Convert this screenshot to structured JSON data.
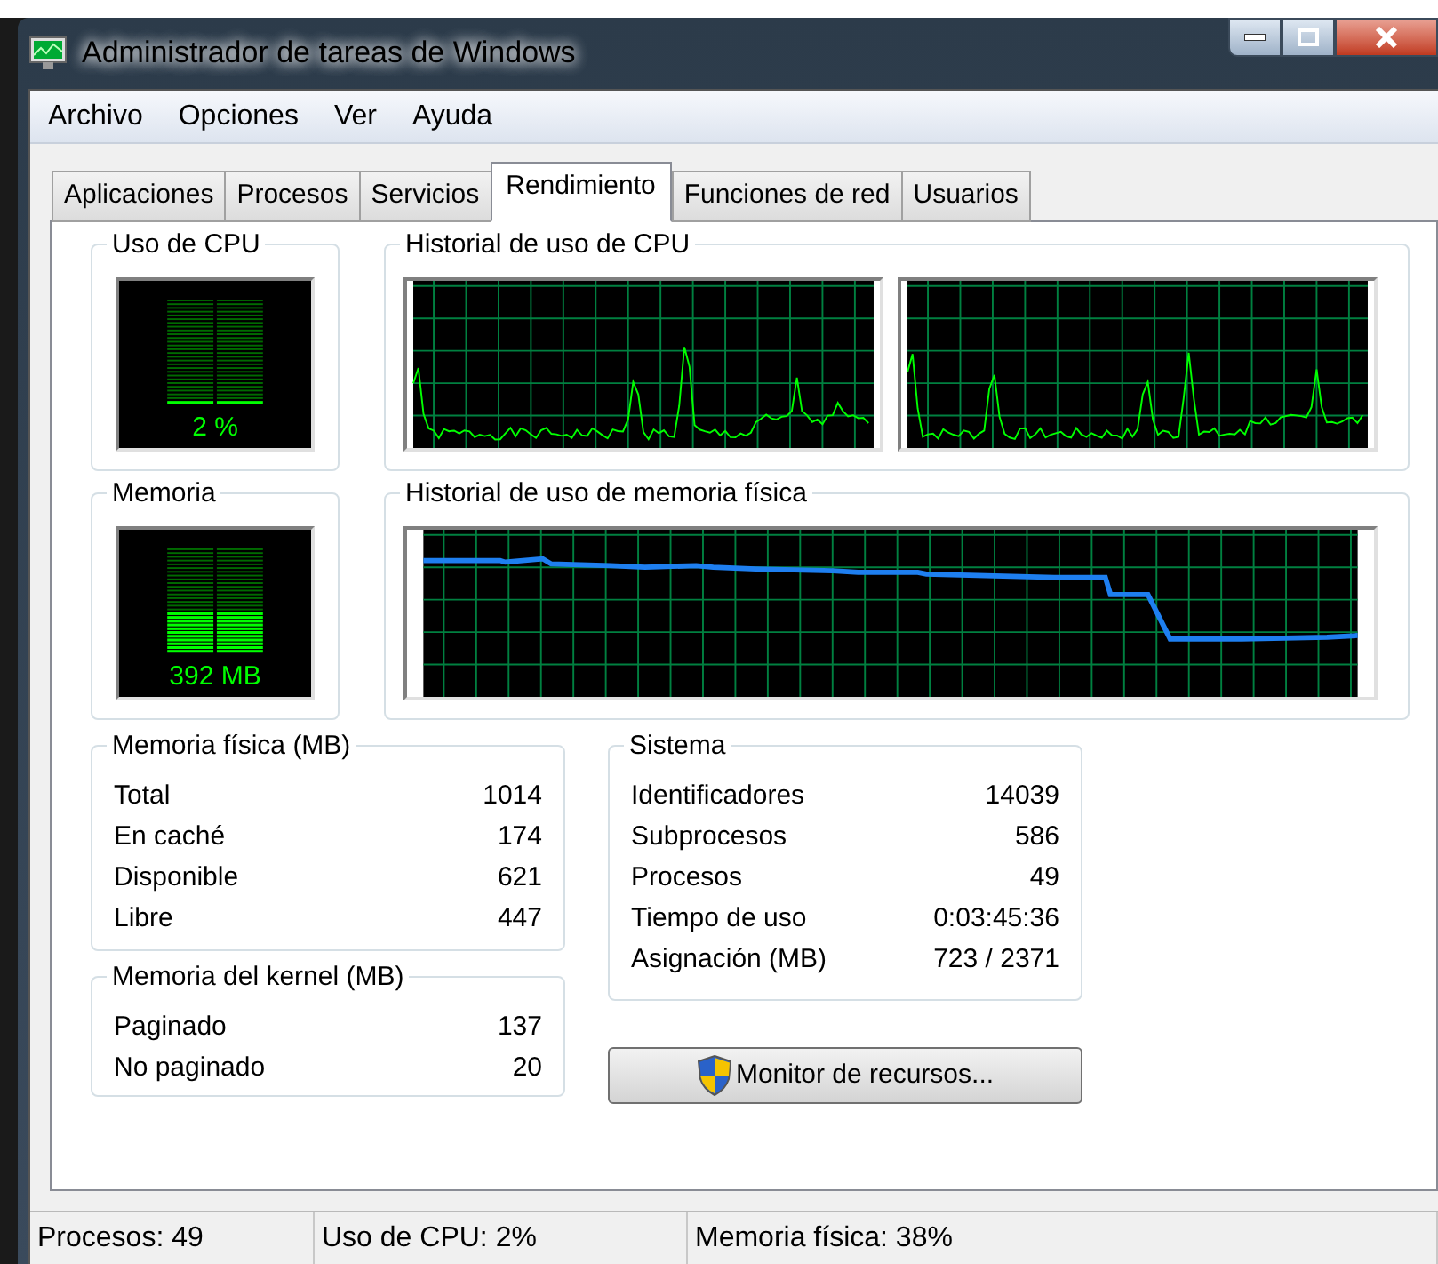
{
  "window": {
    "title": "Administrador de tareas de Windows"
  },
  "menu": [
    "Archivo",
    "Opciones",
    "Ver",
    "Ayuda"
  ],
  "tabs": [
    {
      "label": "Aplicaciones",
      "selected": false
    },
    {
      "label": "Procesos",
      "selected": false
    },
    {
      "label": "Servicios",
      "selected": false
    },
    {
      "label": "Rendimiento",
      "selected": true
    },
    {
      "label": "Funciones de red",
      "selected": false
    },
    {
      "label": "Usuarios",
      "selected": false
    }
  ],
  "cpu_usage": {
    "title": "Uso de CPU",
    "reading": "2 %"
  },
  "cpu_history": {
    "title": "Historial de uso de CPU"
  },
  "memory": {
    "title": "Memoria",
    "reading": "392 MB"
  },
  "memory_history": {
    "title": "Historial de uso de memoria física"
  },
  "physical_memory": {
    "title": "Memoria física (MB)",
    "rows": [
      {
        "label": "Total",
        "value": "1014"
      },
      {
        "label": "En caché",
        "value": "174"
      },
      {
        "label": "Disponible",
        "value": "621"
      },
      {
        "label": "Libre",
        "value": "447"
      }
    ]
  },
  "kernel_memory": {
    "title": "Memoria del kernel (MB)",
    "rows": [
      {
        "label": "Paginado",
        "value": "137"
      },
      {
        "label": "No paginado",
        "value": "20"
      }
    ]
  },
  "system": {
    "title": "Sistema",
    "rows": [
      {
        "label": "Identificadores",
        "value": "14039"
      },
      {
        "label": "Subprocesos",
        "value": "586"
      },
      {
        "label": "Procesos",
        "value": "49"
      },
      {
        "label": "Tiempo de uso",
        "value": "0:03:45:36"
      },
      {
        "label": "Asignación (MB)",
        "value": "723 / 2371"
      }
    ]
  },
  "resource_monitor_button": "Monitor de recursos...",
  "status_bar": [
    "Procesos: 49",
    "Uso de CPU: 2%",
    "Memoria física: 38%"
  ]
}
